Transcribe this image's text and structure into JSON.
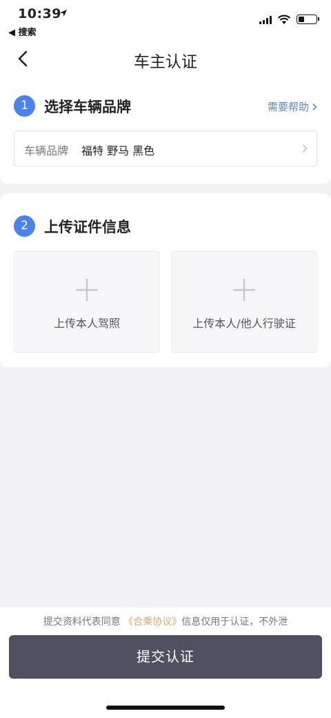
{
  "status_bar": {
    "time": "10:39",
    "back_app": "◀ 搜索"
  },
  "nav": {
    "title": "车主认证"
  },
  "step1": {
    "number": "1",
    "title": "选择车辆品牌",
    "help": "需要帮助",
    "brand_label": "车辆品牌",
    "brand_value": "福特 野马 黑色"
  },
  "step2": {
    "number": "2",
    "title": "上传证件信息",
    "upload_license": "上传本人驾照",
    "upload_registration": "上传本人/他人行驶证"
  },
  "footer": {
    "agree_prefix": "提交资料代表同意",
    "agree_link": "《合乘协议》",
    "agree_suffix": "信息仅用于认证，不外泄",
    "submit_label": "提交认证"
  },
  "colors": {
    "accent_blue": "#4a82ee",
    "link_orange": "#e0a465",
    "submit_bg": "#515060"
  }
}
